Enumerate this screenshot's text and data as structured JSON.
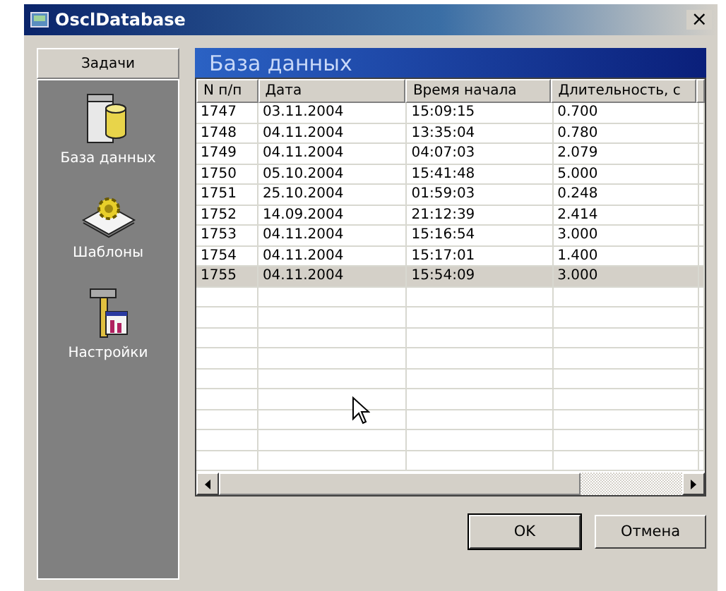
{
  "window": {
    "title": "OsclDatabase",
    "close": "×"
  },
  "sidebar": {
    "header": "Задачи",
    "items": [
      {
        "label": "База данных",
        "kind": "database"
      },
      {
        "label": "Шаблоны",
        "kind": "templates"
      },
      {
        "label": "Настройки",
        "kind": "settings"
      }
    ]
  },
  "panel": {
    "title": "База данных"
  },
  "table": {
    "columns": [
      "N п/п",
      "Дата",
      "Время начала",
      "Длительность, с"
    ],
    "rows": [
      {
        "cells": [
          "1747",
          "03.11.2004",
          "15:09:15",
          "0.700"
        ],
        "selected": false
      },
      {
        "cells": [
          "1748",
          "04.11.2004",
          "13:35:04",
          "0.780"
        ],
        "selected": false
      },
      {
        "cells": [
          "1749",
          "04.11.2004",
          "04:07:03",
          "2.079"
        ],
        "selected": false
      },
      {
        "cells": [
          "1750",
          "05.10.2004",
          "15:41:48",
          "5.000"
        ],
        "selected": false
      },
      {
        "cells": [
          "1751",
          "25.10.2004",
          "01:59:03",
          "0.248"
        ],
        "selected": false
      },
      {
        "cells": [
          "1752",
          "14.09.2004",
          "21:12:39",
          "2.414"
        ],
        "selected": false
      },
      {
        "cells": [
          "1753",
          "04.11.2004",
          "15:16:54",
          "3.000"
        ],
        "selected": false
      },
      {
        "cells": [
          "1754",
          "04.11.2004",
          "15:17:01",
          "1.400"
        ],
        "selected": false
      },
      {
        "cells": [
          "1755",
          "04.11.2004",
          "15:54:09",
          "3.000"
        ],
        "selected": true
      }
    ]
  },
  "buttons": [
    "OK",
    "Отмена"
  ]
}
